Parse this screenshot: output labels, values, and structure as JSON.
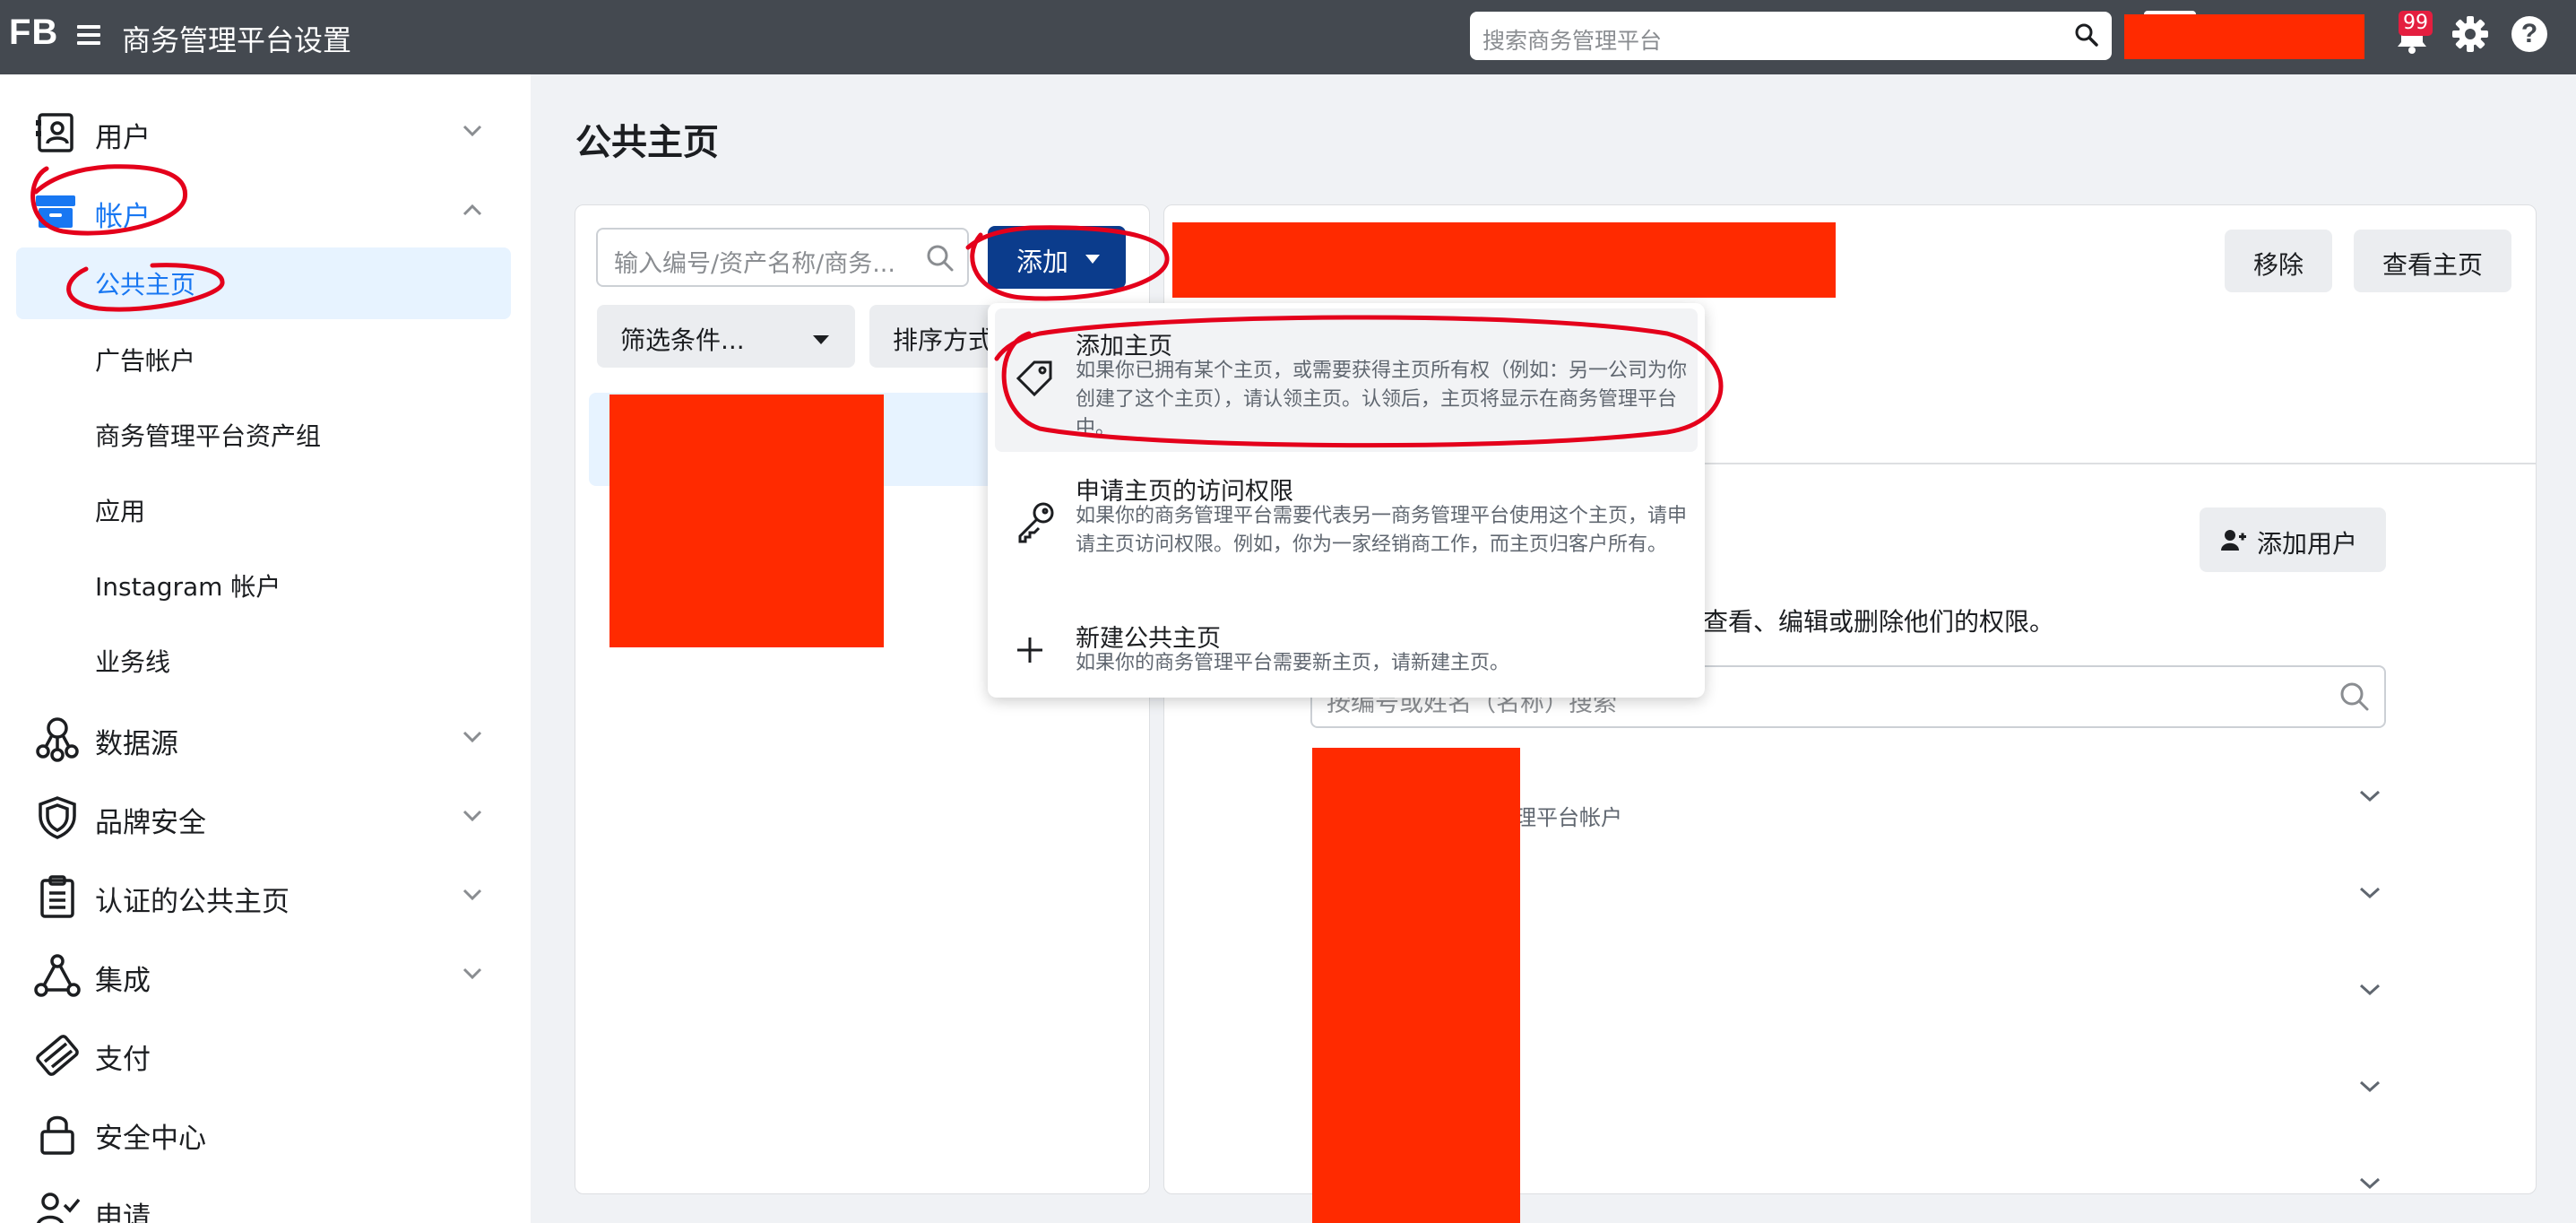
{
  "topbar": {
    "logo": "FB",
    "title": "商务管理平台设置",
    "search_placeholder": "搜索商务管理平台",
    "notification_count": "99",
    "help_symbol": "?"
  },
  "sidebar": {
    "sections": [
      {
        "label": "用户",
        "icon": "users-icon",
        "expanded": false
      },
      {
        "label": "帐户",
        "icon": "accounts-icon",
        "expanded": true
      },
      {
        "label": "数据源",
        "icon": "data-sources-icon",
        "expanded": false
      },
      {
        "label": "品牌安全",
        "icon": "shield-icon",
        "expanded": false
      },
      {
        "label": "认证的公共主页",
        "icon": "clipboard-icon",
        "expanded": false
      },
      {
        "label": "集成",
        "icon": "integration-icon",
        "expanded": false
      },
      {
        "label": "支付",
        "icon": "credit-card-icon"
      },
      {
        "label": "安全中心",
        "icon": "lock-icon"
      },
      {
        "label": "申请",
        "icon": "request-icon"
      }
    ],
    "accounts_items": [
      {
        "label": "公共主页",
        "active": true
      },
      {
        "label": "广告帐户"
      },
      {
        "label": "商务管理平台资产组"
      },
      {
        "label": "应用"
      },
      {
        "label": "Instagram 帐户"
      },
      {
        "label": "业务线"
      }
    ]
  },
  "main": {
    "title": "公共主页",
    "asset_search_placeholder": "输入编号/资产名称/商务...",
    "add_button": "添加",
    "filter_button": "筛选条件...",
    "sort_button": "排序方式",
    "add_menu": [
      {
        "title": "添加主页",
        "description": "如果你已拥有某个主页，或需要获得主页所有权（例如：另一公司为你创建了这个主页），请认领主页。认领后，主页将显示在商务管理平台中。",
        "icon": "tag-icon",
        "highlighted": true
      },
      {
        "title": "申请主页的访问权限",
        "description": "如果你的商务管理平台需要代表另一商务管理平台使用这个主页，请申请主页访问权限。例如，你为一家经销商工作，而主页归客户所有。",
        "icon": "key-icon"
      },
      {
        "title": "新建公共主页",
        "description": "如果你的商务管理平台需要新主页，请新建主页。",
        "icon": "plus-icon"
      }
    ],
    "detail": {
      "remove_button": "移除",
      "view_button": "查看主页",
      "add_user_button": "添加用户",
      "description_fragment": "查看、编辑或删除他们的权限。",
      "people_search_placeholder": "按编号或姓名（名称）搜索",
      "row_subtitle_fragment": "理平台帐户"
    }
  },
  "colors": {
    "topbar": "#444950",
    "accent": "#1877f2",
    "add_button": "#0b3c8c",
    "redaction": "#ff2a00",
    "annotation": "#e4001b"
  }
}
